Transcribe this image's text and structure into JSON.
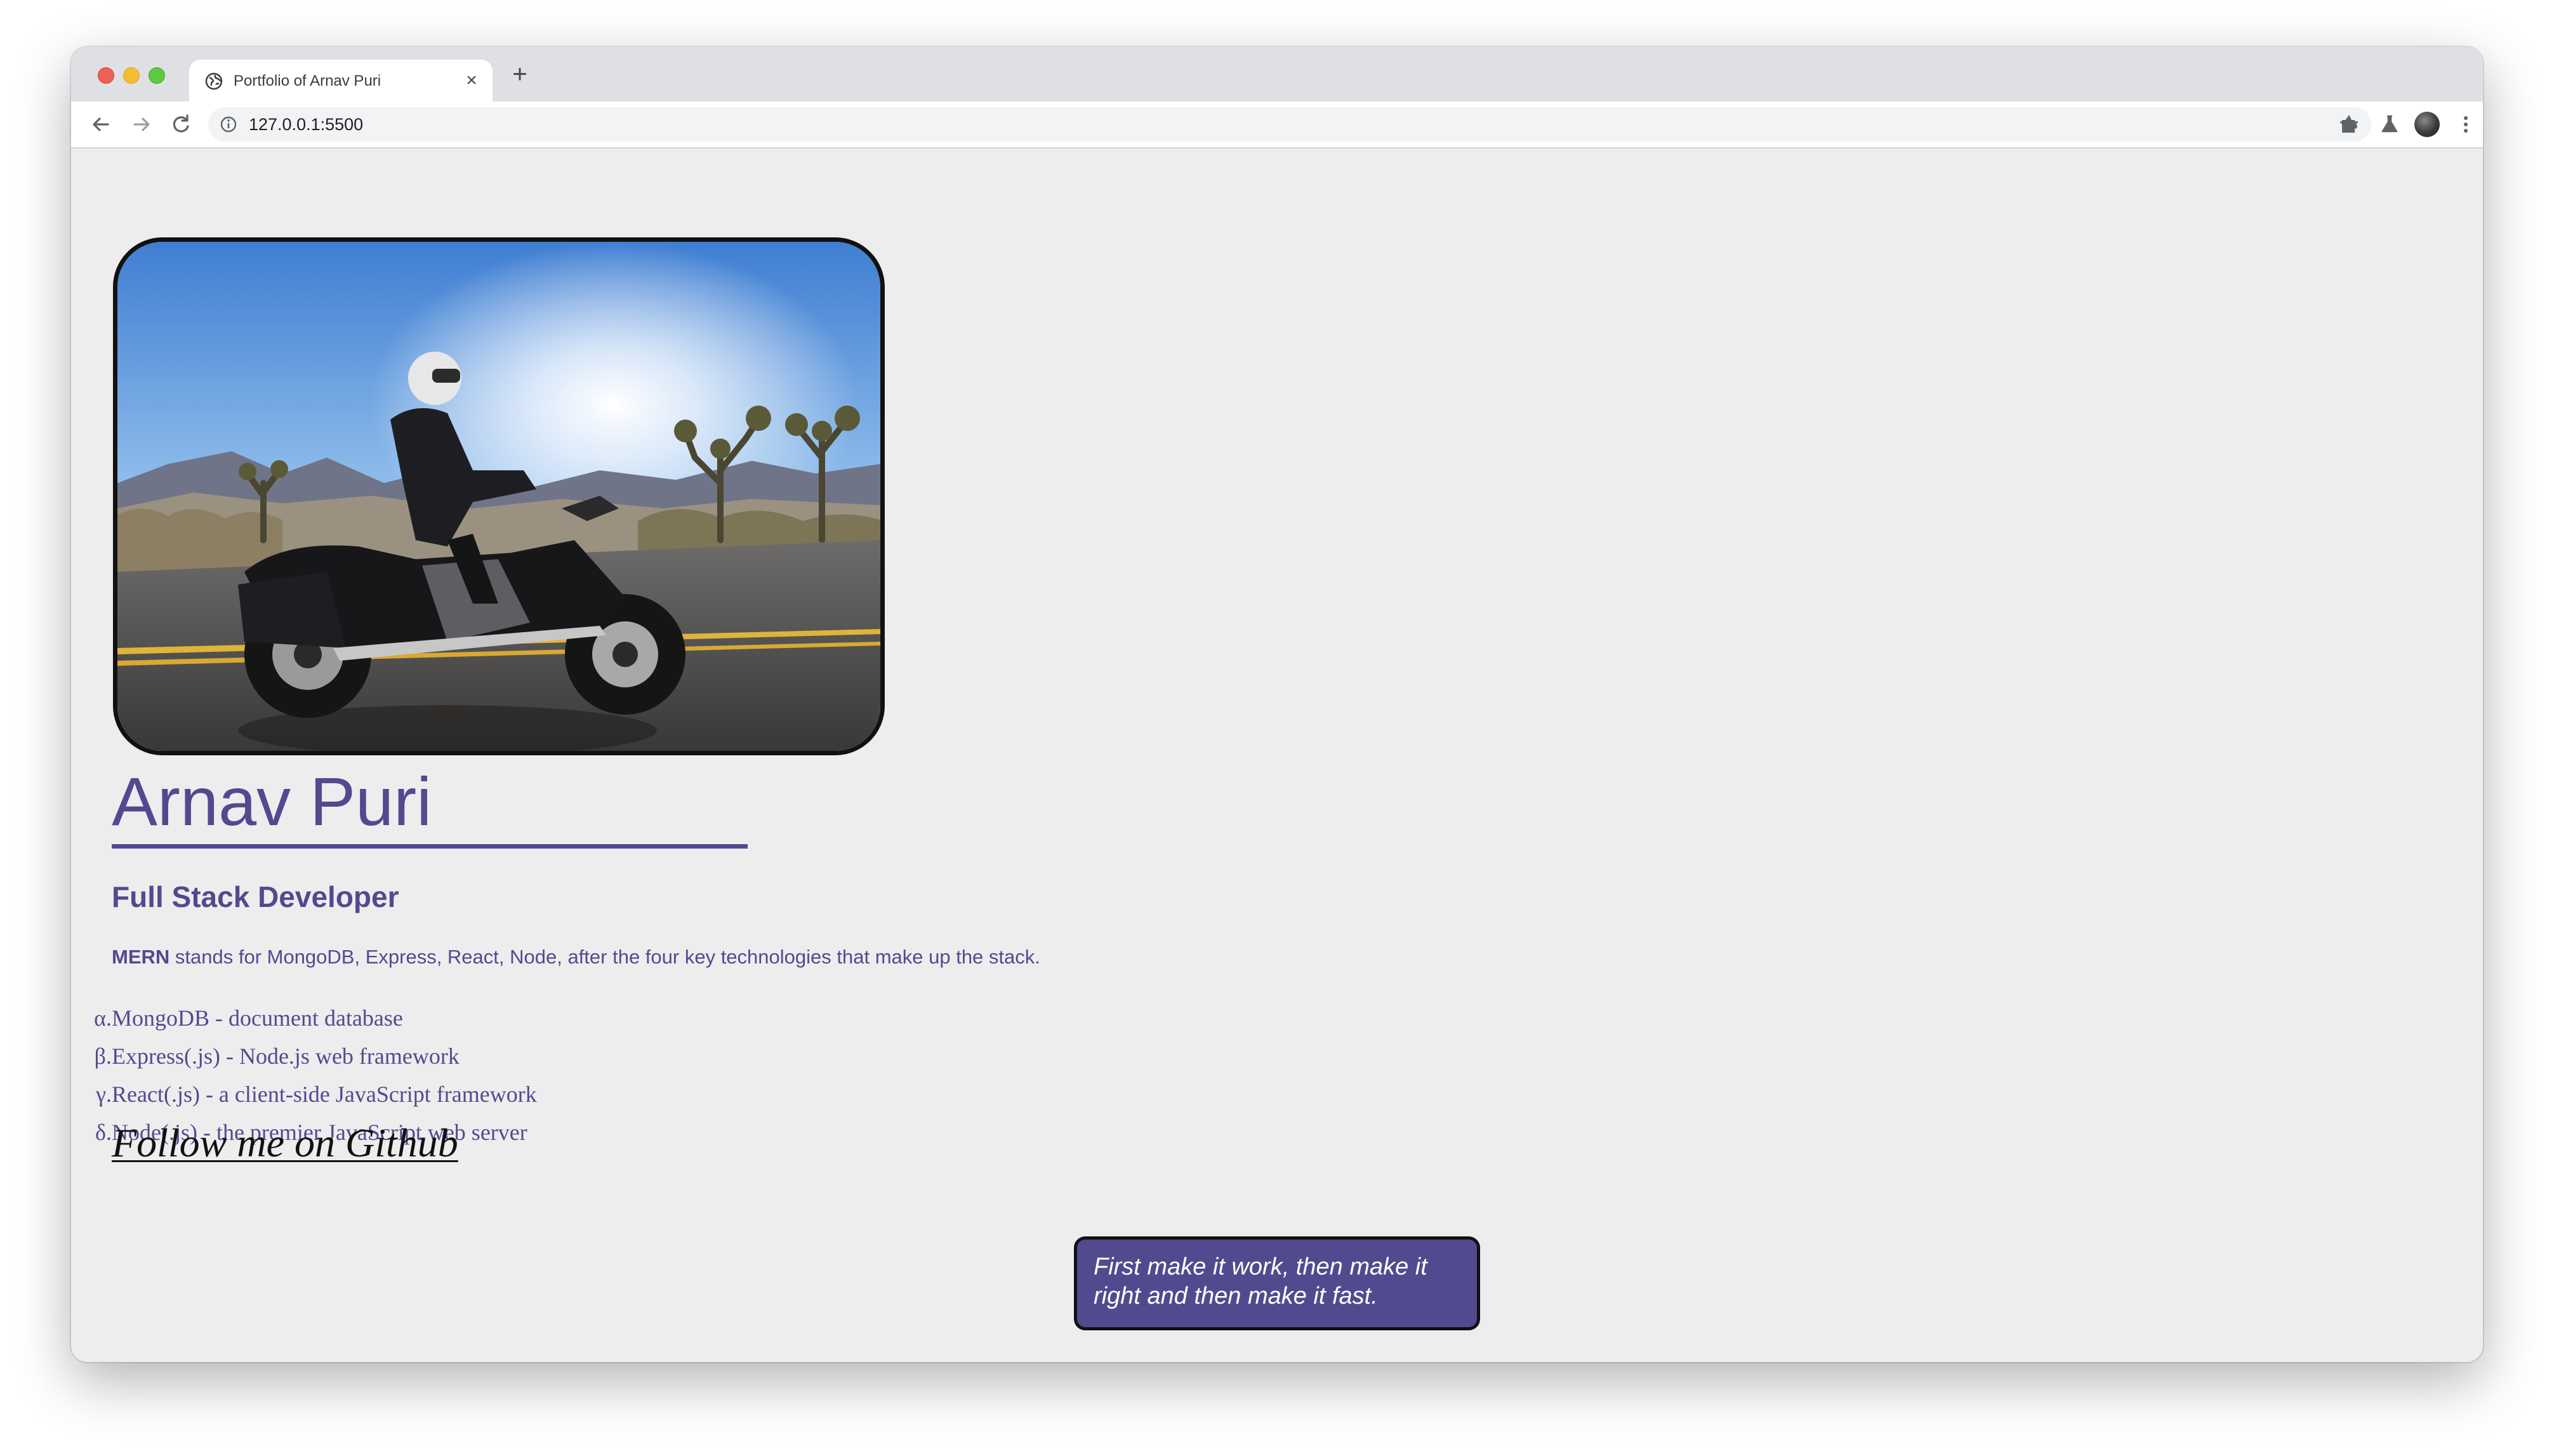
{
  "browser": {
    "tab_title": "Portfolio of Arnav Puri",
    "url": "127.0.0.1:5500",
    "icons": {
      "favicon": "globe-icon",
      "tab_close": "close-icon",
      "new_tab": "plus-icon",
      "back": "arrow-left-icon",
      "forward": "arrow-right-icon",
      "reload": "reload-icon",
      "site_info": "info-icon",
      "bookmark": "star-icon",
      "extensions": "puzzle-icon",
      "labs": "flask-icon",
      "profile": "avatar",
      "menu": "kebab-menu-icon"
    }
  },
  "page": {
    "name": "Arnav Puri",
    "subtitle": "Full Stack Developer",
    "intro": {
      "strong": "MERN",
      "rest": " stands for MongoDB, Express, React, Node, after the four key technologies that make up the stack."
    },
    "tech_list": [
      {
        "marker": "α.",
        "text": "MongoDB - document database"
      },
      {
        "marker": "β.",
        "text": "Express(.js) - Node.js web framework"
      },
      {
        "marker": "γ.",
        "text": "React(.js) - a client-side JavaScript framework"
      },
      {
        "marker": "δ.",
        "text": "Node(.js) - the premier JavaScript web server"
      }
    ],
    "github_link": "Follow me on Github",
    "quote": "First make it work, then make it right and then make it fast."
  },
  "colors": {
    "accent": "#524a8f",
    "page_background": "#ededee",
    "quote_text": "#ffffff"
  }
}
